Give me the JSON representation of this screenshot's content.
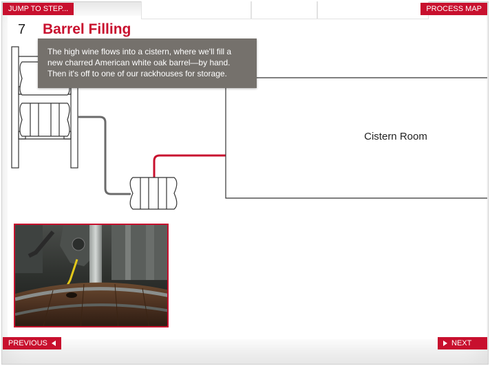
{
  "nav": {
    "jump_label": "JUMP TO STEP...",
    "process_map_label": "PROCESS MAP",
    "previous_label": "PREVIOUS",
    "next_label": "NEXT"
  },
  "step": {
    "number": "7",
    "title": "Barrel Filling"
  },
  "tooltip": {
    "text": "The high wine flows into a cistern, where we'll fill a new charred American white oak barrel—by hand. Then it's off to one of our rackhouses for storage."
  },
  "diagram": {
    "room_label": "Cistern Room",
    "pipe_colors": {
      "active": "#c8102e",
      "inactive": "#6b6b6b"
    }
  },
  "colors": {
    "accent": "#c8102e",
    "tooltip_bg": "#75716c",
    "frame_bg": "#f3f3f3"
  },
  "icons": {
    "previous": "triangle-left-icon",
    "next": "triangle-right-icon"
  }
}
